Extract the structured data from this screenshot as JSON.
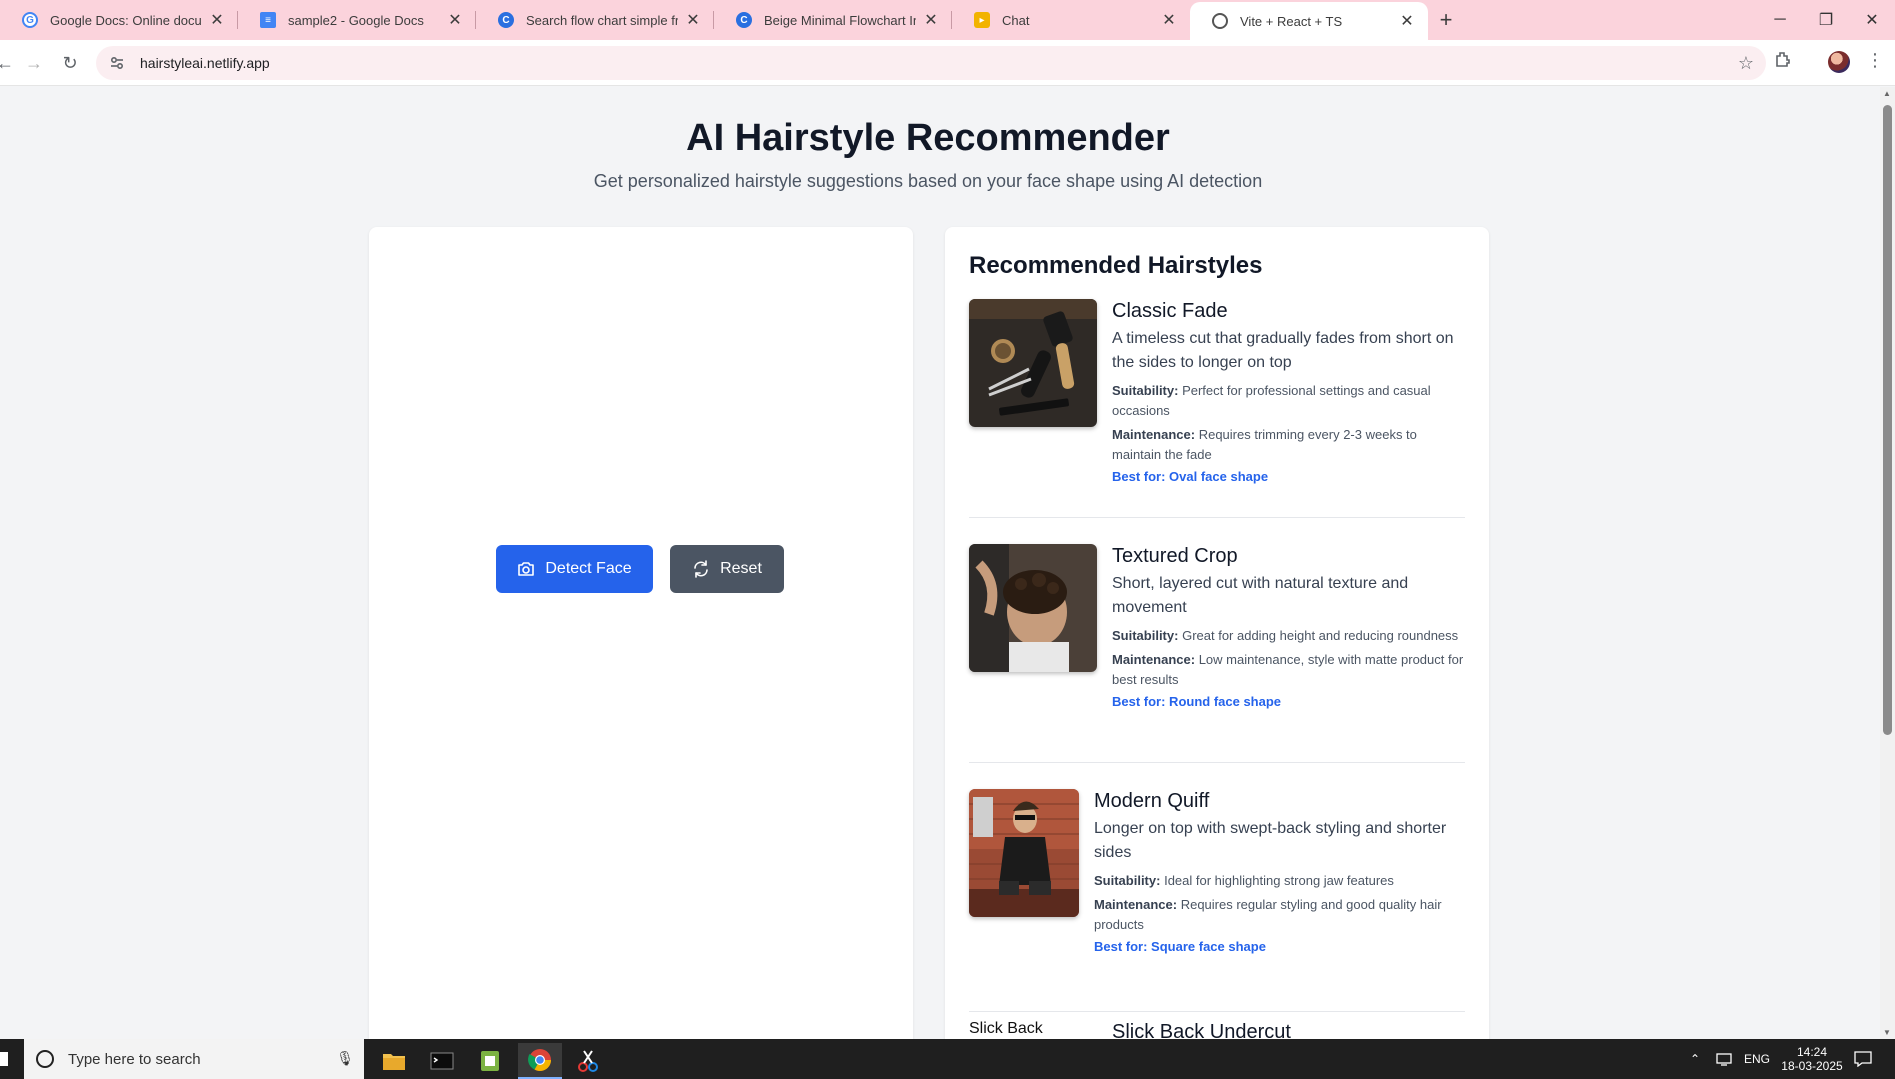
{
  "browser": {
    "tabs": [
      {
        "title": "Google Docs: Online document",
        "favicon": "google-icon",
        "color": "#ffffff"
      },
      {
        "title": "sample2 - Google Docs",
        "favicon": "docs-icon",
        "color": "#4285f4"
      },
      {
        "title": "Search flow chart simple free - C",
        "favicon": "canva-icon",
        "color": "#2a6fe0"
      },
      {
        "title": "Beige Minimal Flowchart Infogr",
        "favicon": "canva-icon",
        "color": "#2a6fe0"
      },
      {
        "title": "Chat",
        "favicon": "chat-icon",
        "color": "#f2b300"
      },
      {
        "title": "Vite + React + TS",
        "favicon": "globe-icon",
        "color": "#555555"
      }
    ],
    "url": "hairstyleai.netlify.app"
  },
  "page": {
    "title": "AI Hairstyle Recommender",
    "subtitle": "Get personalized hairstyle suggestions based on your face shape using AI detection",
    "buttons": {
      "detect": "Detect Face",
      "reset": "Reset"
    },
    "recommendations": {
      "heading": "Recommended Hairstyles",
      "items": [
        {
          "name": "Classic Fade",
          "description": "A timeless cut that gradually fades from short on the sides to longer on top",
          "suitability_label": "Suitability:",
          "suitability": "Perfect for professional settings and casual occasions",
          "maintenance_label": "Maintenance:",
          "maintenance": "Requires trimming every 2-3 weeks to maintain the fade",
          "best_for": "Best for: Oval face shape"
        },
        {
          "name": "Textured Crop",
          "description": "Short, layered cut with natural texture and movement",
          "suitability_label": "Suitability:",
          "suitability": "Great for adding height and reducing roundness",
          "maintenance_label": "Maintenance:",
          "maintenance": "Low maintenance, style with matte product for best results",
          "best_for": "Best for: Round face shape"
        },
        {
          "name": "Modern Quiff",
          "description": "Longer on top with swept-back styling and shorter sides",
          "suitability_label": "Suitability:",
          "suitability": "Ideal for highlighting strong jaw features",
          "maintenance_label": "Maintenance:",
          "maintenance": "Requires regular styling and good quality hair products",
          "best_for": "Best for: Square face shape"
        },
        {
          "name": "Slick Back Undercut",
          "image_alt": "Slick Back"
        }
      ]
    }
  },
  "taskbar": {
    "search_placeholder": "Type here to search",
    "language": "ENG",
    "time": "14:24",
    "date": "18-03-2025"
  },
  "colors": {
    "primary": "#2563eb",
    "secondary": "#4b5563",
    "tabstrip": "#fbd3dc"
  }
}
